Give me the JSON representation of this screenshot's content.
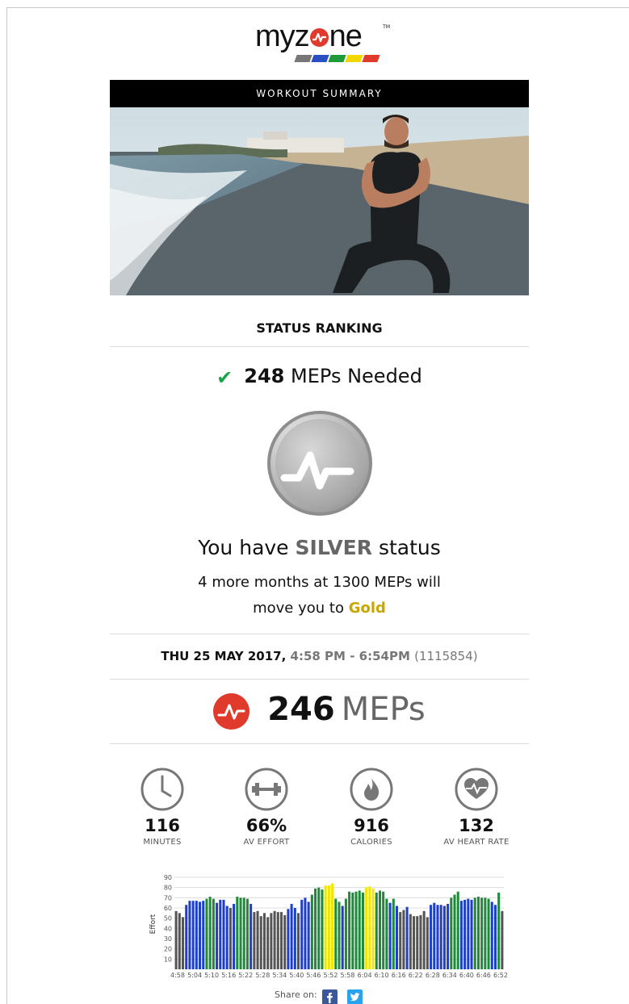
{
  "brand": {
    "logo_text_pre": "myz",
    "logo_text_post": "ne",
    "logo_tm": "TM",
    "bar_colors": [
      "#777777",
      "#2a4fc0",
      "#1e9a3a",
      "#f2d600",
      "#e03a2d"
    ]
  },
  "banner": {
    "title": "WORKOUT SUMMARY"
  },
  "status": {
    "heading": "STATUS RANKING",
    "meps_needed_value": "248",
    "meps_needed_label": "MEPs Needed",
    "have_prefix": "You have",
    "level": "SILVER",
    "have_suffix": "status",
    "sub_line1": "4 more months at 1300 MEPs will",
    "sub_prefix2": "move you to",
    "next_level": "Gold"
  },
  "session": {
    "date": "THU 25 MAY 2017,",
    "time": "4:58 PM - 6:54PM",
    "workout_id": "(1115854)"
  },
  "meps": {
    "value": "246",
    "unit": "MEPs"
  },
  "stats": [
    {
      "value": "116",
      "label": "MINUTES",
      "icon": "clock-icon"
    },
    {
      "value": "66%",
      "label": "AV EFFORT",
      "icon": "dumbbell-icon"
    },
    {
      "value": "916",
      "label": "CALORIES",
      "icon": "flame-icon"
    },
    {
      "value": "132",
      "label": "AV HEART RATE",
      "icon": "heart-rate-icon"
    }
  ],
  "chart_data": {
    "type": "bar",
    "ylabel": "Effort",
    "ylim": [
      0,
      90
    ],
    "yticks": [
      10,
      20,
      30,
      40,
      50,
      60,
      70,
      80,
      90
    ],
    "xticks": [
      "4:58",
      "5:04",
      "5:10",
      "5:16",
      "5:22",
      "5:28",
      "5:34",
      "5:40",
      "5:46",
      "5:52",
      "5:58",
      "6:04",
      "6:10",
      "6:16",
      "6:22",
      "6:28",
      "6:34",
      "6:40",
      "6:46",
      "6:52"
    ],
    "zone_colors": {
      "gray": "#555555",
      "blue": "#1f3fc9",
      "green": "#1e8a3a",
      "yellow": "#f2e600"
    },
    "values": [
      57,
      55,
      51,
      63,
      67,
      67,
      67,
      66,
      67,
      69,
      71,
      69,
      65,
      68,
      68,
      62,
      60,
      64,
      71,
      70,
      70,
      69,
      64,
      56,
      57,
      52,
      55,
      51,
      55,
      57,
      56,
      56,
      53,
      59,
      64,
      60,
      55,
      68,
      70,
      66,
      73,
      79,
      80,
      78,
      82,
      82,
      84,
      69,
      66,
      62,
      69,
      76,
      75,
      76,
      77,
      75,
      80,
      81,
      79,
      75,
      77,
      76,
      69,
      65,
      69,
      62,
      56,
      58,
      61,
      54,
      52,
      52,
      53,
      57,
      51,
      63,
      65,
      63,
      63,
      62,
      64,
      70,
      73,
      76,
      67,
      68,
      69,
      68,
      70,
      71,
      70,
      70,
      69,
      66,
      63,
      75,
      57
    ],
    "zones": [
      "gray",
      "gray",
      "gray",
      "blue",
      "blue",
      "blue",
      "blue",
      "blue",
      "blue",
      "green",
      "green",
      "green",
      "blue",
      "blue",
      "blue",
      "blue",
      "gray",
      "blue",
      "green",
      "green",
      "green",
      "green",
      "blue",
      "gray",
      "gray",
      "gray",
      "gray",
      "gray",
      "gray",
      "gray",
      "gray",
      "gray",
      "gray",
      "blue",
      "blue",
      "blue",
      "gray",
      "blue",
      "blue",
      "blue",
      "green",
      "green",
      "green",
      "green",
      "yellow",
      "yellow",
      "yellow",
      "green",
      "green",
      "blue",
      "green",
      "green",
      "green",
      "green",
      "green",
      "green",
      "yellow",
      "yellow",
      "yellow",
      "green",
      "green",
      "green",
      "green",
      "blue",
      "green",
      "blue",
      "gray",
      "gray",
      "blue",
      "gray",
      "gray",
      "gray",
      "gray",
      "gray",
      "gray",
      "blue",
      "blue",
      "blue",
      "blue",
      "blue",
      "blue",
      "green",
      "green",
      "green",
      "blue",
      "blue",
      "blue",
      "blue",
      "green",
      "green",
      "green",
      "green",
      "green",
      "blue",
      "blue",
      "green",
      "gray"
    ]
  },
  "share": {
    "label": "Share on:"
  }
}
